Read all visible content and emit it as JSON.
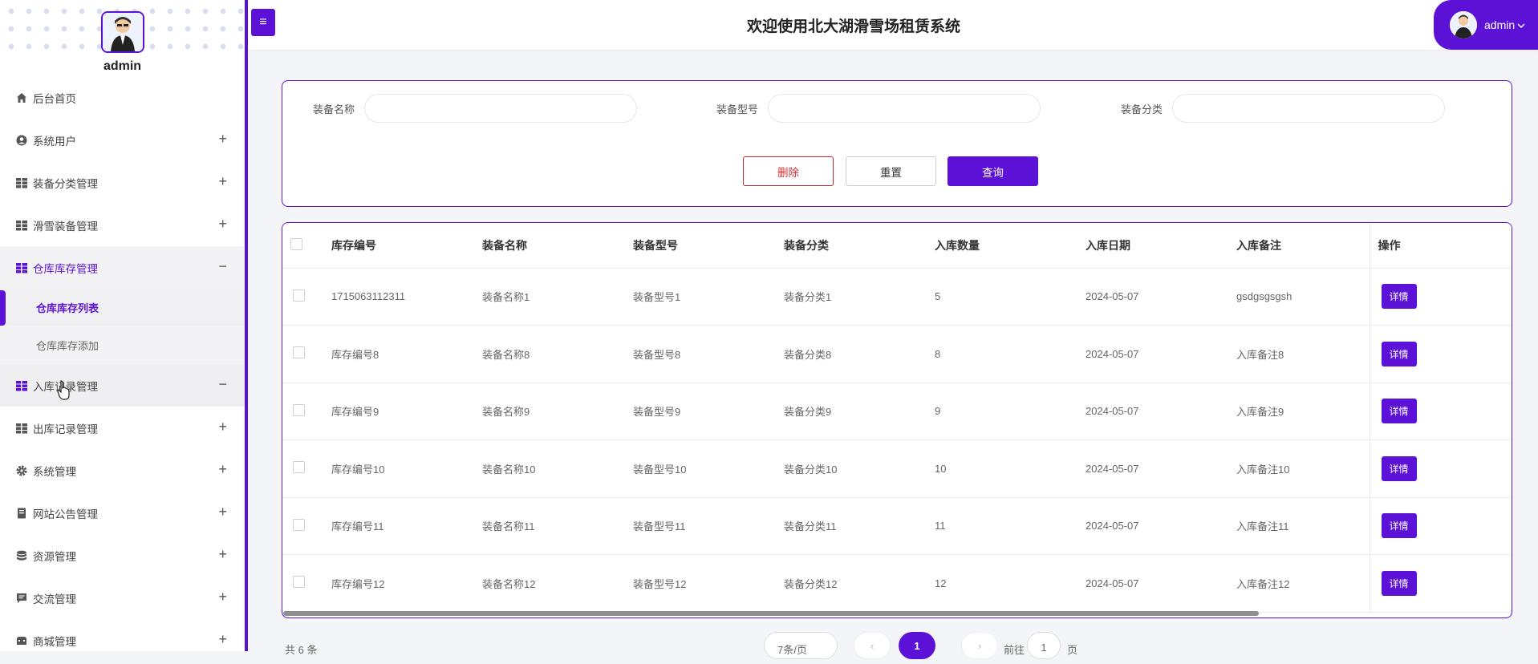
{
  "sidebar": {
    "username": "admin",
    "items": [
      {
        "label": "后台首页",
        "icon": "home-icon",
        "sign": ""
      },
      {
        "label": "系统用户",
        "icon": "user-circle-icon",
        "sign": "+"
      },
      {
        "label": "装备分类管理",
        "icon": "grid-icon",
        "sign": "+"
      },
      {
        "label": "滑雪装备管理",
        "icon": "grid-icon",
        "sign": "+"
      },
      {
        "label": "仓库库存管理",
        "icon": "grid-icon",
        "sign": "−"
      },
      {
        "label": "入库记录管理",
        "icon": "grid-icon",
        "sign": "−"
      },
      {
        "label": "出库记录管理",
        "icon": "grid-icon",
        "sign": "+"
      },
      {
        "label": "系统管理",
        "icon": "gear-icon",
        "sign": "+"
      },
      {
        "label": "网站公告管理",
        "icon": "document-icon",
        "sign": "+"
      },
      {
        "label": "资源管理",
        "icon": "database-icon",
        "sign": "+"
      },
      {
        "label": "交流管理",
        "icon": "chat-icon",
        "sign": "+"
      },
      {
        "label": "商城管理",
        "icon": "store-icon",
        "sign": "+"
      }
    ],
    "subitems": [
      {
        "label": "仓库库存列表"
      },
      {
        "label": "仓库库存添加"
      }
    ]
  },
  "topbar": {
    "menu_toggle": "≡",
    "title": "欢迎使用北大湖滑雪场租赁系统",
    "user": "admin"
  },
  "search": {
    "fields": [
      {
        "label": "装备名称",
        "value": ""
      },
      {
        "label": "装备型号",
        "value": ""
      },
      {
        "label": "装备分类",
        "value": ""
      }
    ],
    "delete_label": "删除",
    "reset_label": "重置",
    "query_label": "查询"
  },
  "table": {
    "headers": [
      "库存编号",
      "装备名称",
      "装备型号",
      "装备分类",
      "入库数量",
      "入库日期",
      "入库备注",
      "操作"
    ],
    "rows": [
      [
        "1715063112311",
        "装备名称1",
        "装备型号1",
        "装备分类1",
        "5",
        "2024-05-07",
        "gsdgsgsgsh"
      ],
      [
        "库存编号8",
        "装备名称8",
        "装备型号8",
        "装备分类8",
        "8",
        "2024-05-07",
        "入库备注8"
      ],
      [
        "库存编号9",
        "装备名称9",
        "装备型号9",
        "装备分类9",
        "9",
        "2024-05-07",
        "入库备注9"
      ],
      [
        "库存编号10",
        "装备名称10",
        "装备型号10",
        "装备分类10",
        "10",
        "2024-05-07",
        "入库备注10"
      ],
      [
        "库存编号11",
        "装备名称11",
        "装备型号11",
        "装备分类11",
        "11",
        "2024-05-07",
        "入库备注11"
      ],
      [
        "库存编号12",
        "装备名称12",
        "装备型号12",
        "装备分类12",
        "12",
        "2024-05-07",
        "入库备注12"
      ]
    ],
    "detail_label": "详情"
  },
  "pager": {
    "total": "共 6 条",
    "page_size": "7条/页",
    "prev": "‹",
    "current": "1",
    "next": "›",
    "goto": "前往",
    "goto_value": "1",
    "page_suffix": "页"
  },
  "colors": {
    "accent": "#5b12d6",
    "danger": "#d32f2f"
  }
}
